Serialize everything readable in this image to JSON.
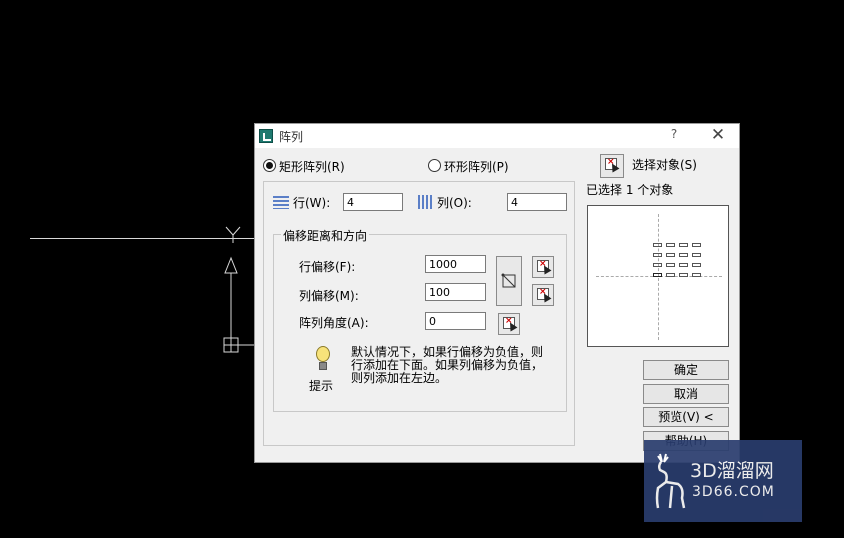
{
  "dialog": {
    "title": "阵列",
    "help_glyph": "?",
    "close_glyph": "✕",
    "rect_array_label": "矩形阵列(R)",
    "polar_array_label": "环形阵列(P)",
    "rect_selected": true,
    "rows_label": "行(W):",
    "rows_value": "4",
    "cols_label": "列(O):",
    "cols_value": "4",
    "offset_group_title": "偏移距离和方向",
    "row_offset_label": "行偏移(F):",
    "row_offset_value": "1000",
    "col_offset_label": "列偏移(M):",
    "col_offset_value": "100",
    "angle_label": "阵列角度(A):",
    "angle_value": "0",
    "tip_line1": "默认情况下，如果行偏移为负值，则",
    "tip_line2": "行添加在下面。如果列偏移为负值，",
    "tip_line3": "则列添加在左边。",
    "tip_caption": "提示",
    "select_objects_label": "选择对象(S)",
    "selected_count_text": "已选择 1 个对象",
    "ok_label": "确定",
    "cancel_label": "取消",
    "preview_label": "预览(V) <",
    "help_label": "帮助(H)"
  },
  "watermark": {
    "line1": "3D溜溜网",
    "line2": "3D66.COM"
  },
  "colors": {
    "canvas_bg": "#000000",
    "dialog_bg": "#f0f0f0",
    "watermark_bg": "#2a3d6e"
  }
}
